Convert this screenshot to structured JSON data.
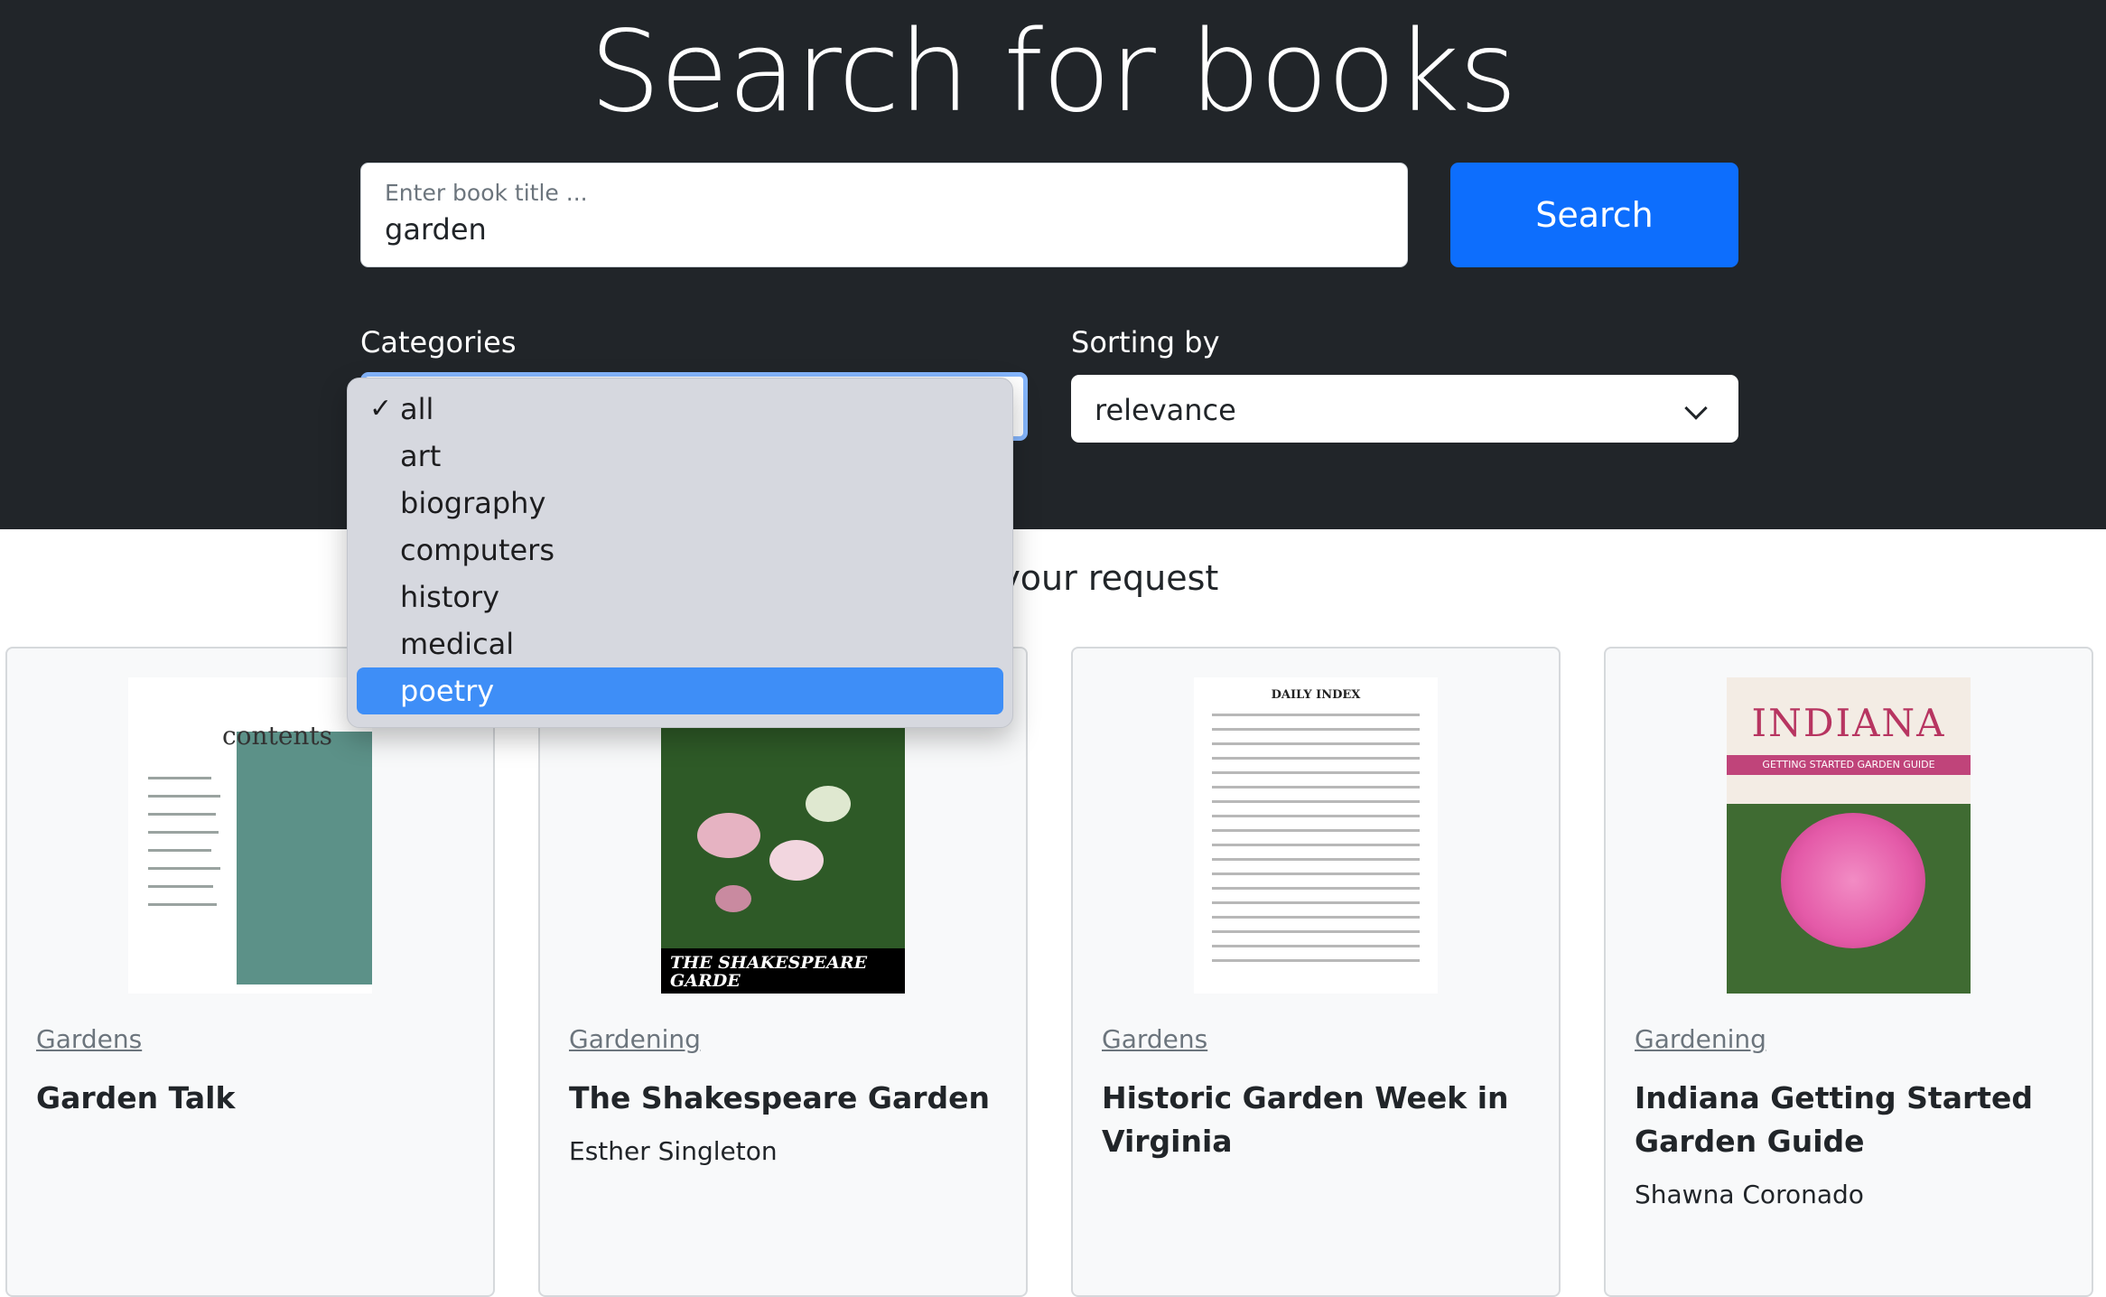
{
  "header": {
    "title": "Search for books"
  },
  "search": {
    "placeholder": "Enter book title ...",
    "value": "garden",
    "button_label": "Search"
  },
  "filters": {
    "categories_label": "Categories",
    "sorting_label": "Sorting by",
    "sorting_value": "relevance",
    "categories_options": [
      "all",
      "art",
      "biography",
      "computers",
      "history",
      "medical",
      "poetry"
    ],
    "checked_option": "all",
    "hovered_option": "poetry"
  },
  "results": {
    "heading_visible": "nd for your request"
  },
  "cards": [
    {
      "category": "Gardens",
      "title": "Garden Talk",
      "author": ""
    },
    {
      "category": "Gardening",
      "title": "The Shakespeare Garden",
      "author": "Esther Singleton"
    },
    {
      "category": "Gardens",
      "title": "Historic Garden Week in Virginia",
      "author": ""
    },
    {
      "category": "Gardening",
      "title": "Indiana Getting Started Garden Guide",
      "author": "Shawna Coronado"
    }
  ],
  "covers": {
    "cover1_word": "contents",
    "cover2_banner": "THE SHAKESPEARE GARDE",
    "cover3_heading": "DAILY INDEX",
    "cover4_word": "INDIANA",
    "cover4_strip": "GETTING STARTED GARDEN GUIDE"
  },
  "colors": {
    "header_bg": "#212529",
    "primary": "#0d6efd",
    "dropdown_highlight": "#3e8ef7"
  }
}
